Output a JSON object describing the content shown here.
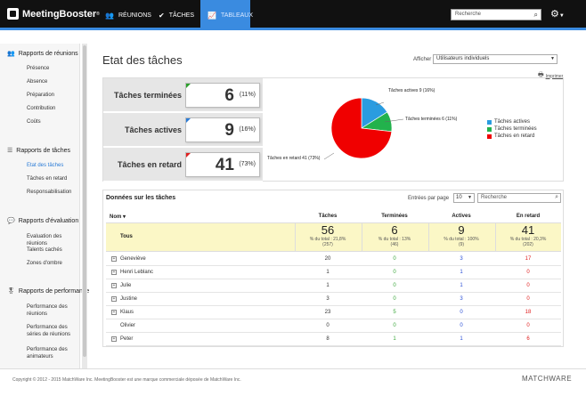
{
  "app": {
    "brand": "MeetingBooster",
    "nav": [
      {
        "label": "RÉUNIONS",
        "icon": "people-icon"
      },
      {
        "label": "TÂCHES",
        "icon": "check-circle-icon"
      },
      {
        "label": "TABLEAUX",
        "icon": "chart-icon"
      }
    ],
    "search_placeholder": "Recherche"
  },
  "sidebar": {
    "sections": [
      {
        "title": "Rapports de réunions",
        "items": [
          "Présence",
          "Absence",
          "Préparation",
          "Contribution",
          "Coûts"
        ]
      },
      {
        "title": "Rapports de tâches",
        "items": [
          "Etat des tâches",
          "Tâches en retard",
          "Responsabilisation"
        ]
      },
      {
        "title": "Rapports d'évaluation",
        "items": [
          "Evaluation des réunions",
          "Talents cachés",
          "Zones d'ombre"
        ]
      },
      {
        "title": "Rapports de performance",
        "items": [
          "Performance des réunions",
          "Performance des séries de réunions",
          "Performance des animateurs"
        ]
      }
    ]
  },
  "main": {
    "title": "Etat des tâches",
    "afficher_label": "Afficher",
    "afficher_value": "Utilisateurs individuels",
    "print_label": "Imprimer",
    "stats": [
      {
        "label": "Tâches terminées",
        "value": "6",
        "pct": "(11%)",
        "color": "#2ca02c"
      },
      {
        "label": "Tâches actives",
        "value": "9",
        "pct": "(16%)",
        "color": "#2a7bd6"
      },
      {
        "label": "Tâches en retard",
        "value": "41",
        "pct": "(73%)",
        "color": "#e02020"
      }
    ],
    "pie_labels": {
      "active": "Tâches actives 9 (16%)",
      "done": "Tâches terminées 6 (11%)",
      "late": "Tâches en retard 41 (73%)"
    },
    "legend": [
      {
        "label": "Tâches actives",
        "color": "#2a9ce0"
      },
      {
        "label": "Tâches terminées",
        "color": "#22b24c"
      },
      {
        "label": "Tâches en retard",
        "color": "#f00000"
      }
    ]
  },
  "table": {
    "title": "Données sur les tâches",
    "entries_label": "Entrées par page",
    "entries_value": "10",
    "search_placeholder": "Recherche",
    "columns": [
      "Nom ▾",
      "Tâches",
      "Terminées",
      "Actives",
      "En retard"
    ],
    "totals": {
      "label": "Tous",
      "taches": {
        "num": "56",
        "sub1": "% du total : 21,8%",
        "sub2": "(257)"
      },
      "terminees": {
        "num": "6",
        "sub1": "% du total : 13%",
        "sub2": "(46)"
      },
      "actives": {
        "num": "9",
        "sub1": "% du total : 100%",
        "sub2": "(9)"
      },
      "retard": {
        "num": "41",
        "sub1": "% du total : 20,3%",
        "sub2": "(202)"
      }
    },
    "rows": [
      {
        "name": "Geneviève",
        "expand": true,
        "taches": "20",
        "terminees": "0",
        "actives": "3",
        "retard": "17"
      },
      {
        "name": "Henri Leblanc",
        "expand": true,
        "taches": "1",
        "terminees": "0",
        "actives": "1",
        "retard": "0"
      },
      {
        "name": "Julie",
        "expand": true,
        "taches": "1",
        "terminees": "0",
        "actives": "1",
        "retard": "0"
      },
      {
        "name": "Justine",
        "expand": true,
        "taches": "3",
        "terminees": "0",
        "actives": "3",
        "retard": "0"
      },
      {
        "name": "Klaus",
        "expand": true,
        "taches": "23",
        "terminees": "5",
        "actives": "0",
        "retard": "18"
      },
      {
        "name": "Olivier",
        "expand": false,
        "taches": "0",
        "terminees": "0",
        "actives": "0",
        "retard": "0"
      },
      {
        "name": "Peter",
        "expand": true,
        "taches": "8",
        "terminees": "1",
        "actives": "1",
        "retard": "6"
      }
    ]
  },
  "footer": {
    "copyright": "Copyright © 2012 - 2015 MatchWare Inc. MeetingBooster est une marque commerciale déposée de MatchWare Inc.",
    "brand": "MATCHWARE"
  },
  "chart_data": {
    "type": "pie",
    "categories": [
      "Tâches actives",
      "Tâches terminées",
      "Tâches en retard"
    ],
    "values": [
      9,
      6,
      41
    ],
    "colors": [
      "#2a9ce0",
      "#22b24c",
      "#f00000"
    ],
    "legend": "right"
  }
}
